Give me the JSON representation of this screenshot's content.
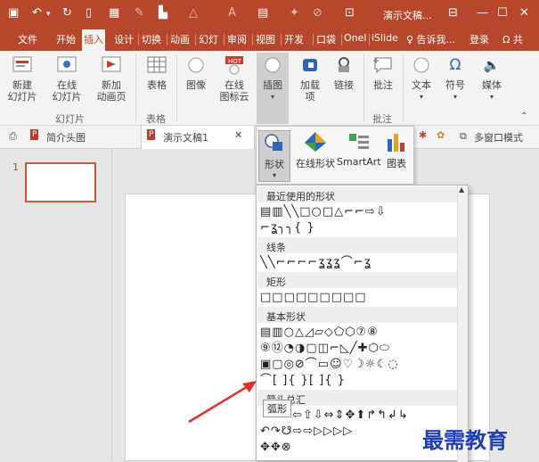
{
  "titlebar": {
    "title": "演示文稿...",
    "close_glyph": "✕",
    "min_glyph": "—",
    "max_glyph": "☐"
  },
  "tabs": [
    {
      "label": "文件"
    },
    {
      "label": "开始"
    },
    {
      "label": "插入",
      "active": true
    },
    {
      "label": "设计"
    },
    {
      "label": "切换"
    },
    {
      "label": "动画"
    },
    {
      "label": "幻灯"
    },
    {
      "label": "审阅"
    },
    {
      "label": "视图"
    },
    {
      "label": "开发"
    },
    {
      "label": "口袋"
    },
    {
      "label": "Onel"
    },
    {
      "label": "iSlide"
    },
    {
      "label": "♀ 告诉我..."
    },
    {
      "label": "登录"
    },
    {
      "label": "Ω 共"
    }
  ],
  "ribbon": {
    "new_slide": "新建\n幻灯片",
    "online_slide": "在线\n幻灯片",
    "new_anim_page": "新加\n动画页",
    "group_slides": "幻灯片",
    "table": "表格",
    "group_tables": "表格",
    "image": "图像",
    "online_icon_cloud": "在线\n图标云",
    "illustration": "插图",
    "addin": "加载\n项",
    "link": "链接",
    "comment": "批注",
    "group_comments": "批注",
    "text": "文本",
    "symbol": "符号",
    "media": "媒体",
    "hot_badge": "HOT"
  },
  "doc_tabs": {
    "tab1": "简介头图",
    "tab2": "演示文稿1",
    "multiwin": "多窗口模式"
  },
  "thumb": {
    "number": "1"
  },
  "illustrations": {
    "shapes": "形状",
    "online_shapes": "在线形状",
    "smartart": "SmartArt",
    "chart": "图表"
  },
  "shapes_menu": {
    "sections": [
      {
        "title": "最近使用的形状"
      },
      {
        "title": "线条"
      },
      {
        "title": "矩形"
      },
      {
        "title": "基本形状"
      },
      {
        "title": "箭头总汇"
      }
    ],
    "recent_rows": [
      "▤▥╲╲□○□△⌐⌐⇨⇩",
      "⌐ʓ╮╮{ }"
    ],
    "line_rows": [
      "╲╲⌐⌐⌐⌐ʓʓʓ⌒⌐ʓ"
    ],
    "rect_rows": [
      "□□□□□□□□□"
    ],
    "basic_rows": [
      "▤▥○△◿▱◇⬠⬡⑦⑧",
      "⑨⑫◔◑▢◫⌐◺╱✚⬡⬭",
      "▣▢◎⊘⌒▭☺♡☽☼☾◌",
      "⌒[ ]{ }[ ]{ }"
    ],
    "arrow_rows": [
      "⇦⇧⇩⇔⇕✥⬆↱↰↲↳",
      "↶↷☋⇨⇨▷▷▷▷",
      "✥✥⊗"
    ],
    "tooltip": "弧形"
  },
  "watermark": "最需教育",
  "colors": {
    "brand": "#b7472a",
    "accent_arrow": "#e03030",
    "watermark": "#1e3fb5"
  }
}
